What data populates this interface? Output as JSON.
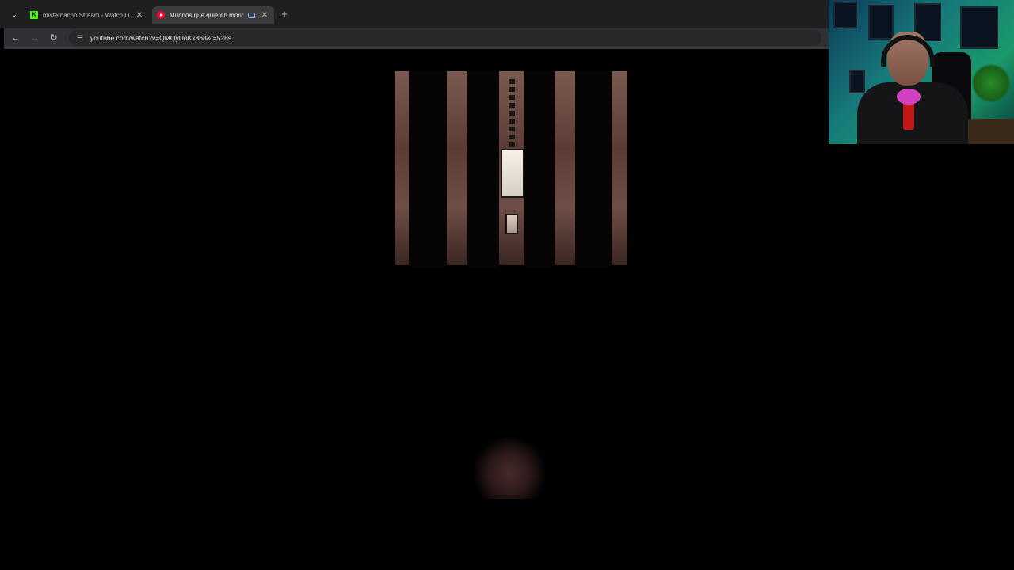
{
  "browser": {
    "tabs": [
      {
        "title": "misternacho Stream - Watch Li",
        "favicon": "kick-icon",
        "active": false
      },
      {
        "title": "Mundos que quieren morir",
        "favicon": "youtube-icon",
        "active": true
      }
    ],
    "url": "youtube.com/watch?v=QMQyUoKx868&t=528s"
  },
  "icons": {
    "tab_menu": "chevron-down-icon",
    "new_tab": "plus-icon",
    "back": "arrow-left-icon",
    "forward": "arrow-right-icon",
    "reload": "reload-icon",
    "site_info": "tune-icon",
    "cast": "cast-icon",
    "close": "close-icon"
  },
  "colors": {
    "kick_brand": "#53fc18",
    "youtube_brand": "#ff0033",
    "chrome_dark": "#1f1f1f"
  },
  "glyphs": {
    "chevron": "⌄",
    "plus": "+",
    "back": "←",
    "forward": "→",
    "reload": "↻",
    "tune": "☰",
    "close": "✕",
    "kick": "K"
  }
}
